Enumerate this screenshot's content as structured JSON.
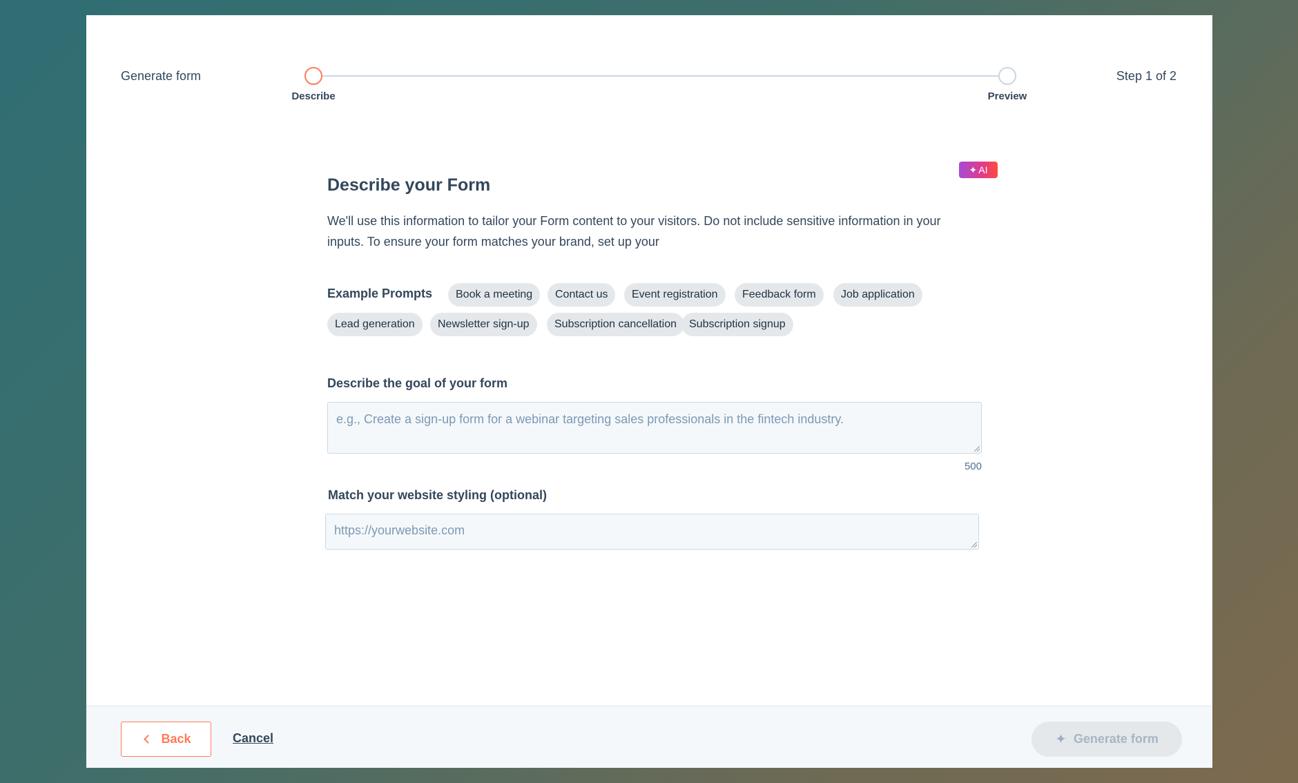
{
  "header": {
    "title": "Generate form",
    "step_indicator": "Step 1 of 2",
    "steps": [
      {
        "label": "Describe",
        "state": "active"
      },
      {
        "label": "Preview",
        "state": "inactive"
      }
    ]
  },
  "content": {
    "title": "Describe your Form",
    "ai_badge": "AI",
    "description": "We'll use this information to tailor your Form content to your visitors. Do not include sensitive information in your inputs. To ensure your form matches your brand, set up your",
    "prompts_label": "Example Prompts",
    "prompts": [
      "Book a meeting",
      "Contact us",
      "Event registration",
      "Feedback form",
      "Job application",
      "Lead generation",
      "Newsletter sign-up",
      "Subscription cancellation",
      "Subscription signup"
    ],
    "goal": {
      "label": "Describe the goal of your form",
      "value": "",
      "placeholder": "e.g., Create a sign-up form for a webinar targeting sales professionals in the fintech industry.",
      "char_limit": "500"
    },
    "styling": {
      "label": "Match your website styling (optional)",
      "value": "",
      "placeholder": "https://yourwebsite.com"
    }
  },
  "footer": {
    "back_label": "Back",
    "cancel_label": "Cancel",
    "generate_label": "Generate form"
  },
  "colors": {
    "accent": "#ff7a59",
    "text": "#33475b",
    "chip_bg": "#e5e8eb",
    "disabled_text": "#a8b5c3"
  }
}
